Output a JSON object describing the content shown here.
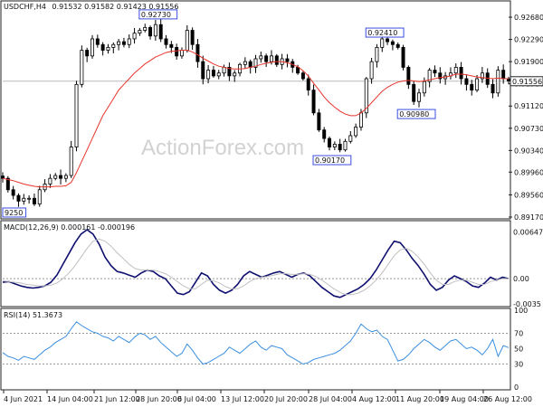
{
  "header": {
    "symbol": "USDCHF,H4",
    "ohlc": "0.91532 0.91582 0.91423 0.91556"
  },
  "watermark": "ActionForex.com",
  "colors": {
    "candles": "#000000",
    "ma": "#e8352c",
    "macd_line": "#101070",
    "signal": "#c0c0c0",
    "rsi": "#3b8fe0",
    "price_tag_bg": "#3b4ee0",
    "current_line": "#bbbbbb",
    "grid_dashed": "#999999"
  },
  "chart_data": [
    {
      "type": "line",
      "title": "USDCHF,H4",
      "subtitle": "0.91532 0.91582 0.91423 0.91556",
      "x_ticks": [
        "4 Jun 2021",
        "14 Jun 04:00",
        "21 Jun 12:00",
        "28 Jun 20:00",
        "6 Jul 04:00",
        "13 Jul 12:00",
        "20 Jul 20:00",
        "28 Jul 04:00",
        "4 Aug 12:00",
        "11 Aug 20:00",
        "19 Aug 04:00",
        "26 Aug 12:00"
      ],
      "y_ticks": [
        "0.92680",
        "0.92290",
        "0.91900",
        "0.91510",
        "0.91120",
        "0.90730",
        "0.90340",
        "0.89960",
        "0.89560",
        "0.89170"
      ],
      "ylim": [
        0.8917,
        0.9276
      ],
      "current_price": "0.91556",
      "annotations": [
        {
          "label": "0.92730",
          "x": 29,
          "y": 0.9273
        },
        {
          "label": "0.92410",
          "x": 72,
          "y": 0.9241
        },
        {
          "label": "0.90980",
          "x": 78,
          "y": 0.9098
        },
        {
          "label": "0.90170",
          "x": 62,
          "y": 0.9017
        },
        {
          "label": "9250",
          "x": 0,
          "y": 0.8925
        }
      ],
      "series": [
        {
          "name": "USDCHF close",
          "values": [
            0.8985,
            0.8965,
            0.8955,
            0.8945,
            0.895,
            0.895,
            0.894,
            0.8965,
            0.8975,
            0.8985,
            0.899,
            0.8985,
            0.899,
            0.904,
            0.915,
            0.921,
            0.92,
            0.923,
            0.922,
            0.921,
            0.9215,
            0.922,
            0.9225,
            0.922,
            0.923,
            0.924,
            0.9245,
            0.925,
            0.9235,
            0.9255,
            0.923,
            0.922,
            0.9215,
            0.92,
            0.921,
            0.9245,
            0.922,
            0.919,
            0.916,
            0.9175,
            0.9165,
            0.917,
            0.918,
            0.9165,
            0.917,
            0.9185,
            0.919,
            0.918,
            0.9195,
            0.92,
            0.919,
            0.92,
            0.9185,
            0.9195,
            0.919,
            0.918,
            0.917,
            0.916,
            0.914,
            0.91,
            0.907,
            0.9055,
            0.904,
            0.9045,
            0.9035,
            0.905,
            0.906,
            0.9075,
            0.91,
            0.916,
            0.919,
            0.9215,
            0.923,
            0.9225,
            0.922,
            0.9215,
            0.918,
            0.915,
            0.912,
            0.9135,
            0.9155,
            0.9175,
            0.917,
            0.916,
            0.9165,
            0.917,
            0.918,
            0.916,
            0.915,
            0.914,
            0.916,
            0.917,
            0.915,
            0.9135,
            0.9175,
            0.916,
            0.9156
          ]
        },
        {
          "name": "MA",
          "values": [
            0.8985,
            0.8983,
            0.8981,
            0.8978,
            0.8975,
            0.8973,
            0.8971,
            0.897,
            0.897,
            0.897,
            0.8971,
            0.8971,
            0.8972,
            0.8978,
            0.8995,
            0.9015,
            0.9035,
            0.9055,
            0.9075,
            0.9095,
            0.911,
            0.9125,
            0.914,
            0.915,
            0.916,
            0.917,
            0.9178,
            0.9186,
            0.9192,
            0.9198,
            0.9202,
            0.9206,
            0.9208,
            0.9209,
            0.921,
            0.921,
            0.9207,
            0.9202,
            0.9196,
            0.9191,
            0.9186,
            0.9182,
            0.918,
            0.9178,
            0.9177,
            0.9177,
            0.9178,
            0.918,
            0.9182,
            0.9185,
            0.9187,
            0.9189,
            0.919,
            0.919,
            0.9188,
            0.9185,
            0.9181,
            0.9174,
            0.9165,
            0.9152,
            0.914,
            0.9128,
            0.9118,
            0.911,
            0.9103,
            0.9098,
            0.9095,
            0.9095,
            0.91,
            0.9108,
            0.9118,
            0.9128,
            0.9138,
            0.9145,
            0.915,
            0.9154,
            0.9156,
            0.9157,
            0.9156,
            0.9155,
            0.9156,
            0.9158,
            0.916,
            0.9162,
            0.9163,
            0.9165,
            0.9168,
            0.9168,
            0.9167,
            0.9165,
            0.9163,
            0.9162,
            0.9161,
            0.916,
            0.9161,
            0.916,
            0.916
          ]
        }
      ]
    },
    {
      "type": "line",
      "title": "MACD(12,26,9) 0.000161 -0.000196",
      "y_ticks": [
        "0.006473",
        "0.00",
        "-0.0035"
      ],
      "ylim": [
        -0.0035,
        0.0068
      ],
      "series": [
        {
          "name": "MACD",
          "values": [
            -0.0005,
            -0.0004,
            -0.0007,
            -0.001,
            -0.0012,
            -0.0013,
            -0.0012,
            -0.001,
            -0.0005,
            0.0005,
            0.002,
            0.0035,
            0.005,
            0.0062,
            0.0068,
            0.0062,
            0.0048,
            0.003,
            0.0018,
            0.001,
            0.0008,
            0.0005,
            0.0002,
            0.0008,
            0.0012,
            0.001,
            0.0004,
            0.0,
            -0.001,
            -0.002,
            -0.0022,
            -0.0018,
            -0.0005,
            0.0008,
            0.0004,
            -0.0008,
            -0.0016,
            -0.002,
            -0.0016,
            -0.0008,
            0.0004,
            0.001,
            0.0006,
            0.0002,
            0.0005,
            0.0008,
            0.001,
            0.0006,
            0.0002,
            0.0006,
            0.0008,
            0.0004,
            -0.0004,
            -0.0012,
            -0.0018,
            -0.0024,
            -0.0026,
            -0.0022,
            -0.0018,
            -0.0014,
            -0.0008,
            0.0,
            0.0012,
            0.0026,
            0.004,
            0.0052,
            0.005,
            0.004,
            0.0028,
            0.0018,
            0.0006,
            -0.0008,
            -0.0016,
            -0.0012,
            -0.0002,
            0.0004,
            0.0,
            -0.0004,
            -0.001,
            -0.0012,
            -0.0006,
            0.0002,
            -0.0002,
            0.0002,
            0.0
          ],
          "color": "#101070"
        },
        {
          "name": "Signal",
          "values": [
            -0.0003,
            -0.0004,
            -0.0005,
            -0.0006,
            -0.0008,
            -0.0009,
            -0.001,
            -0.001,
            -0.0009,
            -0.0006,
            0.0,
            0.0008,
            0.0018,
            0.003,
            0.0042,
            0.0052,
            0.0055,
            0.0052,
            0.0045,
            0.0036,
            0.0028,
            0.002,
            0.0014,
            0.0012,
            0.0012,
            0.0012,
            0.001,
            0.0007,
            0.0002,
            -0.0004,
            -0.001,
            -0.0014,
            -0.0014,
            -0.0008,
            -0.0002,
            -0.0003,
            -0.0006,
            -0.0011,
            -0.0014,
            -0.0014,
            -0.001,
            -0.0004,
            0.0,
            0.0002,
            0.0003,
            0.0005,
            0.0007,
            0.0007,
            0.0006,
            0.0006,
            0.0007,
            0.0006,
            0.0003,
            -0.0002,
            -0.0008,
            -0.0014,
            -0.0019,
            -0.0022,
            -0.0022,
            -0.002,
            -0.0016,
            -0.001,
            -0.0002,
            0.0008,
            0.002,
            0.0032,
            0.004,
            0.0042,
            0.0038,
            0.003,
            0.002,
            0.0008,
            -0.0002,
            -0.0008,
            -0.0008,
            -0.0004,
            -0.0002,
            -0.0002,
            -0.0005,
            -0.0008,
            -0.0008,
            -0.0004,
            -0.0002,
            0.0,
            0.0
          ],
          "color": "#c0c0c0"
        }
      ]
    },
    {
      "type": "line",
      "title": "RSI(14) 51.3673",
      "y_ticks": [
        "100",
        "70",
        "50",
        "30",
        "0"
      ],
      "ylim": [
        0,
        100
      ],
      "series": [
        {
          "name": "RSI",
          "values": [
            45,
            40,
            38,
            35,
            40,
            38,
            36,
            42,
            48,
            52,
            58,
            62,
            66,
            76,
            85,
            80,
            76,
            72,
            70,
            66,
            64,
            60,
            66,
            62,
            58,
            65,
            70,
            68,
            62,
            66,
            58,
            52,
            46,
            40,
            44,
            56,
            48,
            38,
            30,
            32,
            36,
            40,
            44,
            52,
            48,
            44,
            50,
            56,
            60,
            52,
            48,
            54,
            52,
            50,
            42,
            38,
            34,
            30,
            32,
            36,
            38,
            40,
            42,
            44,
            48,
            54,
            60,
            70,
            82,
            76,
            72,
            74,
            66,
            62,
            48,
            34,
            36,
            42,
            50,
            56,
            62,
            58,
            52,
            48,
            54,
            60,
            62,
            56,
            50,
            52,
            48,
            42,
            50,
            62,
            40,
            54,
            51.4
          ],
          "color": "#3b8fe0"
        }
      ]
    }
  ]
}
